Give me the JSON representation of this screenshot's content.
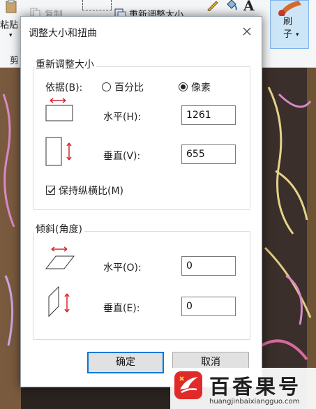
{
  "ribbon": {
    "paste_label": "粘贴",
    "copy_label": "复制",
    "resize_label": "重新调整大小",
    "clip_label": "剪",
    "brush_label": "刷\n子",
    "text_tool_glyph": "A"
  },
  "dialog": {
    "title": "调整大小和扭曲",
    "resize_group": {
      "title": "重新调整大小",
      "by_label": "依据(B):",
      "options": [
        {
          "label": "百分比",
          "checked": false
        },
        {
          "label": "像素",
          "checked": true
        }
      ],
      "horizontal_label": "水平(H):",
      "horizontal_value": "1261",
      "vertical_label": "垂直(V):",
      "vertical_value": "655",
      "keep_ratio_label": "保持纵横比(M)",
      "keep_ratio_checked": true
    },
    "skew_group": {
      "title": "倾斜(角度)",
      "horizontal_label": "水平(O):",
      "horizontal_value": "0",
      "vertical_label": "垂直(E):",
      "vertical_value": "0"
    },
    "ok_label": "确定",
    "cancel_label": "取消"
  },
  "watermark": {
    "title": "百香果号",
    "url": "huangjinbaixiangguo.com"
  },
  "colors": {
    "accent_red": "#d9262c",
    "dialog_border": "#9aa4ad",
    "default_button_border": "#0078d7",
    "brush_highlight": "#cde6f7"
  }
}
